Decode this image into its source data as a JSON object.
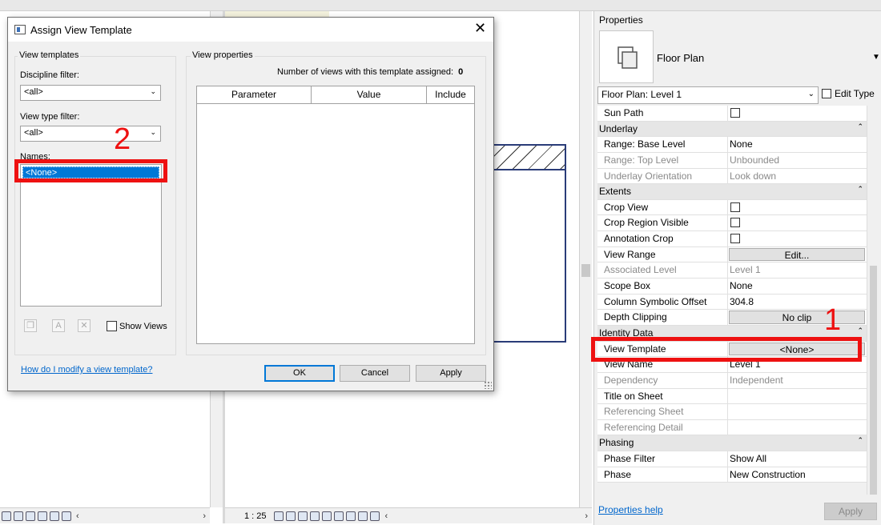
{
  "properties": {
    "title": "Properties",
    "type_name": "Floor Plan",
    "instance_selector": "Floor Plan: Level 1",
    "edit_type_label": "Edit Type",
    "help_link": "Properties help",
    "apply_label": "Apply",
    "rows": [
      {
        "kind": "param",
        "label": "Sun Path",
        "control": "checkbox",
        "dim": false
      },
      {
        "kind": "group",
        "label": "Underlay"
      },
      {
        "kind": "param",
        "label": "Range: Base Level",
        "value": "None",
        "dim": false
      },
      {
        "kind": "param",
        "label": "Range: Top Level",
        "value": "Unbounded",
        "dim": true
      },
      {
        "kind": "param",
        "label": "Underlay Orientation",
        "value": "Look down",
        "dim": true
      },
      {
        "kind": "group",
        "label": "Extents"
      },
      {
        "kind": "param",
        "label": "Crop View",
        "control": "checkbox",
        "dim": false
      },
      {
        "kind": "param",
        "label": "Crop Region Visible",
        "control": "checkbox",
        "dim": false
      },
      {
        "kind": "param",
        "label": "Annotation Crop",
        "control": "checkbox",
        "dim": false
      },
      {
        "kind": "param",
        "label": "View Range",
        "control": "button",
        "value": "Edit...",
        "dim": false
      },
      {
        "kind": "param",
        "label": "Associated Level",
        "value": "Level 1",
        "dim": true
      },
      {
        "kind": "param",
        "label": "Scope Box",
        "value": "None",
        "dim": false
      },
      {
        "kind": "param",
        "label": "Column Symbolic Offset",
        "value": "304.8",
        "dim": false
      },
      {
        "kind": "param",
        "label": "Depth Clipping",
        "control": "button",
        "value": "No clip",
        "dim": false
      },
      {
        "kind": "group",
        "label": "Identity Data"
      },
      {
        "kind": "param",
        "label": "View Template",
        "control": "button",
        "value": "<None>",
        "dim": false
      },
      {
        "kind": "param",
        "label": "View Name",
        "value": "Level 1",
        "dim": false
      },
      {
        "kind": "param",
        "label": "Dependency",
        "value": "Independent",
        "dim": true
      },
      {
        "kind": "param",
        "label": "Title on Sheet",
        "value": "",
        "dim": false
      },
      {
        "kind": "param",
        "label": "Referencing Sheet",
        "value": "",
        "dim": true
      },
      {
        "kind": "param",
        "label": "Referencing Detail",
        "value": "",
        "dim": true
      },
      {
        "kind": "group",
        "label": "Phasing"
      },
      {
        "kind": "param",
        "label": "Phase Filter",
        "value": "Show All",
        "dim": false
      },
      {
        "kind": "param",
        "label": "Phase",
        "value": "New Construction",
        "dim": false
      }
    ]
  },
  "dialog": {
    "title": "Assign View Template",
    "view_templates_label": "View templates",
    "discipline_filter_label": "Discipline filter:",
    "discipline_filter_value": "<all>",
    "view_type_filter_label": "View type filter:",
    "view_type_filter_value": "<all>",
    "names_label": "Names:",
    "names": [
      "<None>"
    ],
    "show_views_label": "Show Views",
    "view_properties_label": "View properties",
    "count_label": "Number of views with this template assigned:",
    "count_value": "0",
    "columns": [
      "Parameter",
      "Value",
      "Include"
    ],
    "help_link": "How do I modify a view template?",
    "ok_label": "OK",
    "cancel_label": "Cancel",
    "apply_label": "Apply"
  },
  "canvas": {
    "scale": "1 : 25"
  },
  "annotations": {
    "num1": "1",
    "num2": "2",
    "color": "#ee1111"
  }
}
